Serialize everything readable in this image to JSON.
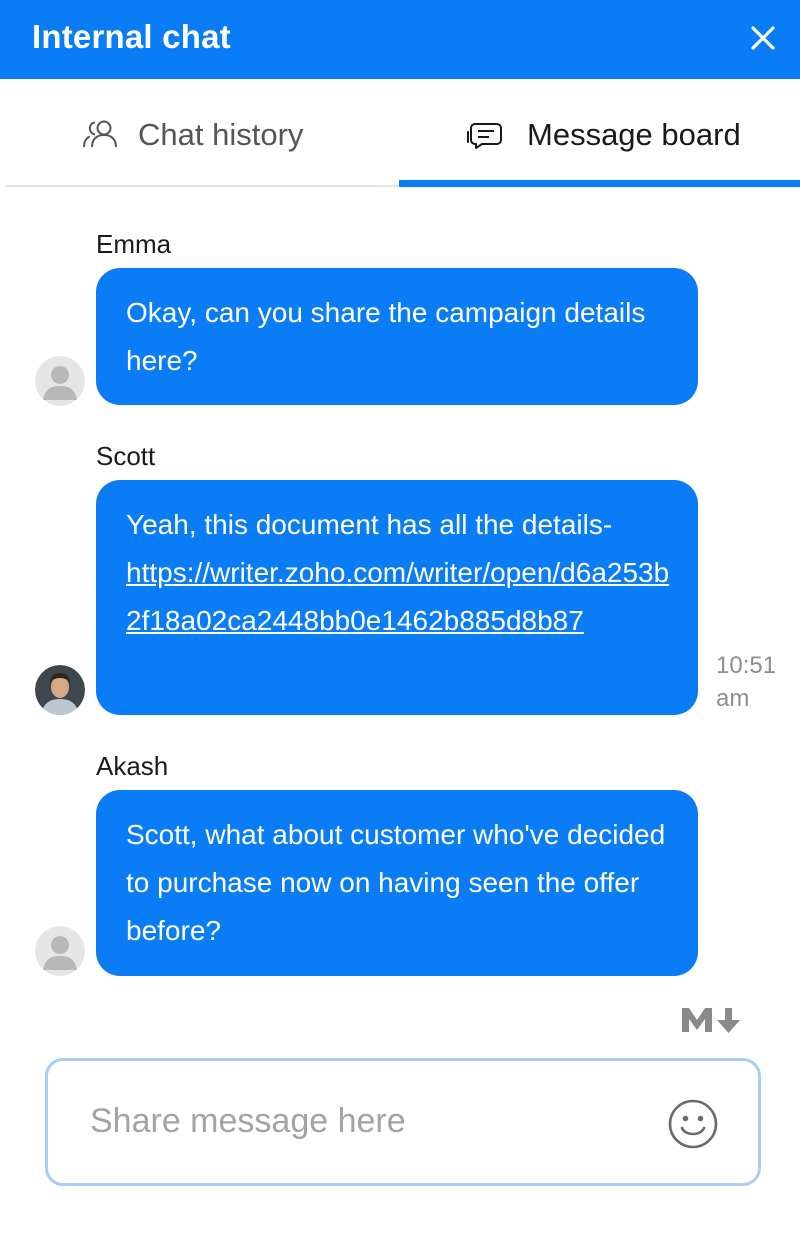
{
  "header": {
    "title": "Internal chat"
  },
  "tabs": [
    {
      "label": "Chat history",
      "icon": "users-icon",
      "active": false
    },
    {
      "label": "Message board",
      "icon": "message-icon",
      "active": true
    }
  ],
  "messages": [
    {
      "sender": "Emma",
      "text": "Okay, can you share the campaign details here?",
      "avatar": "placeholder"
    },
    {
      "sender": "Scott",
      "text": "Yeah, this document has all the details-",
      "link": "https://writer.zoho.com/writer/open/d6a253b2f18a02ca2448bb0e1462b885d8b87",
      "time": "10:51 am",
      "avatar": "photo"
    },
    {
      "sender": "Akash",
      "text": "Scott, what about customer who've decided to purchase now on having seen the offer before?",
      "avatar": "placeholder"
    }
  ],
  "composer": {
    "placeholder": "Share message here",
    "value": ""
  },
  "icons": {
    "markdown": "markdown-icon",
    "emoji": "emoji-icon",
    "close": "close-icon"
  },
  "colors": {
    "accent": "#0a7cf5",
    "composer_border": "#a9cdf5",
    "muted_text": "#8e8e8e"
  }
}
